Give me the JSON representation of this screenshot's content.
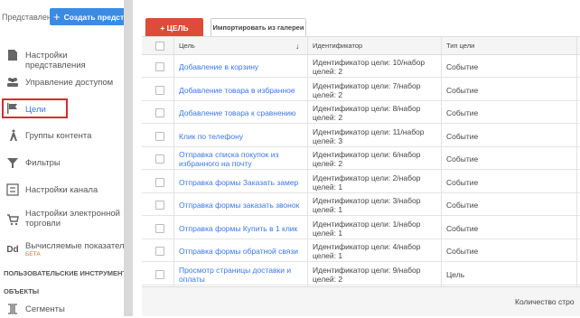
{
  "sidebar": {
    "top_label": "Представление",
    "create_button": "Создать представ",
    "items": [
      {
        "label": "Настройки представления",
        "icon": "document-icon"
      },
      {
        "label": "Управление доступом",
        "icon": "users-icon"
      },
      {
        "label": "Цели",
        "icon": "flag-icon"
      },
      {
        "label": "Группы контента",
        "icon": "person-walk-icon"
      },
      {
        "label": "Фильтры",
        "icon": "filter-icon"
      },
      {
        "label": "Настройки канала",
        "icon": "channel-icon"
      },
      {
        "label": "Настройки электронной торговли",
        "icon": "cart-icon"
      },
      {
        "label": "Вычисляемые показатели",
        "icon": "dd-icon",
        "badge": "БЕТА"
      }
    ],
    "section_tools": "ПОЛЬЗОВАТЕЛЬСКИЕ ИНСТРУМЕНТЫ И",
    "section_objects": "ОБЪЕКТЫ",
    "segments": "Сегменты",
    "highlight_color": "#d62d2d"
  },
  "toolbar": {
    "add_goal": "+ ЦЕЛЬ",
    "import": "Импортировать из галереи",
    "accent": "#dd4b39"
  },
  "table": {
    "headers": {
      "goal": "Цель",
      "sort_arrow": "↓",
      "id": "Идентификатор",
      "type": "Тип цели"
    },
    "rows": [
      {
        "goal": "Добавление в корзину",
        "id": "Идентификатор цели: 10/набор целей: 2",
        "type": "Событие"
      },
      {
        "goal": "Добавление товара в избранное",
        "id": "Идентификатор цели: 7/набор целей: 2",
        "type": "Событие"
      },
      {
        "goal": "Добавление товара к сравнению",
        "id": "Идентификатор цели: 8/набор целей: 2",
        "type": "Событие"
      },
      {
        "goal": "Клик по телефону",
        "id": "Идентификатор цели: 11/набор целей: 3",
        "type": "Событие"
      },
      {
        "goal": "Отправка списка покупок из избранного на почту",
        "id": "Идентификатор цели: 6/набор целей: 2",
        "type": "Событие"
      },
      {
        "goal": "Отправка формы Заказать замер",
        "id": "Идентификатор цели: 2/набор целей: 1",
        "type": "Событие"
      },
      {
        "goal": "Отправка формы заказать звонок",
        "id": "Идентификатор цели: 3/набор целей: 1",
        "type": "Событие"
      },
      {
        "goal": "Отправка формы Купить в 1 клик",
        "id": "Идентификатор цели: 1/набор целей: 1",
        "type": "Событие"
      },
      {
        "goal": "Отправка формы обратной связи",
        "id": "Идентификатор цели: 4/набор целей: 1",
        "type": "Событие"
      },
      {
        "goal": "Просмотр страницы доставки и оплаты",
        "id": "Идентификатор цели: 9/набор целей: 2",
        "type": "Цель"
      }
    ]
  },
  "footer": {
    "rows_label": "Количество стро"
  }
}
